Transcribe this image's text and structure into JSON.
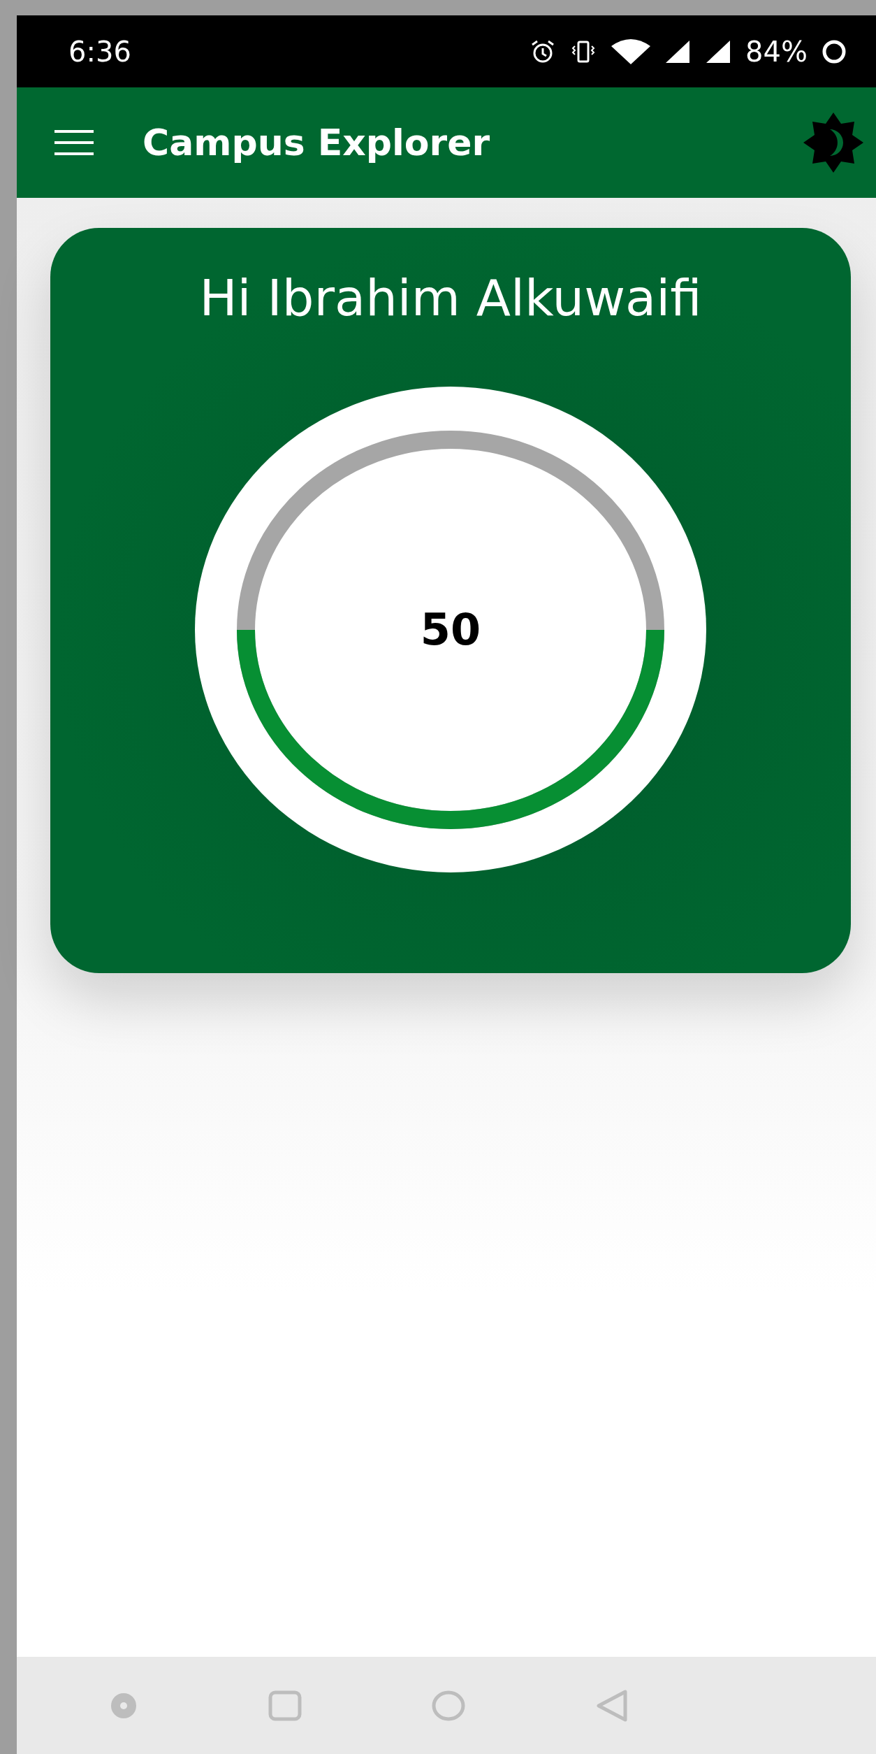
{
  "status_bar": {
    "time": "6:36",
    "battery": "84%"
  },
  "app_bar": {
    "title": "Campus Explorer"
  },
  "card": {
    "greeting": "Hi Ibrahim Alkuwaifi",
    "gauge": {
      "value": "50"
    }
  }
}
